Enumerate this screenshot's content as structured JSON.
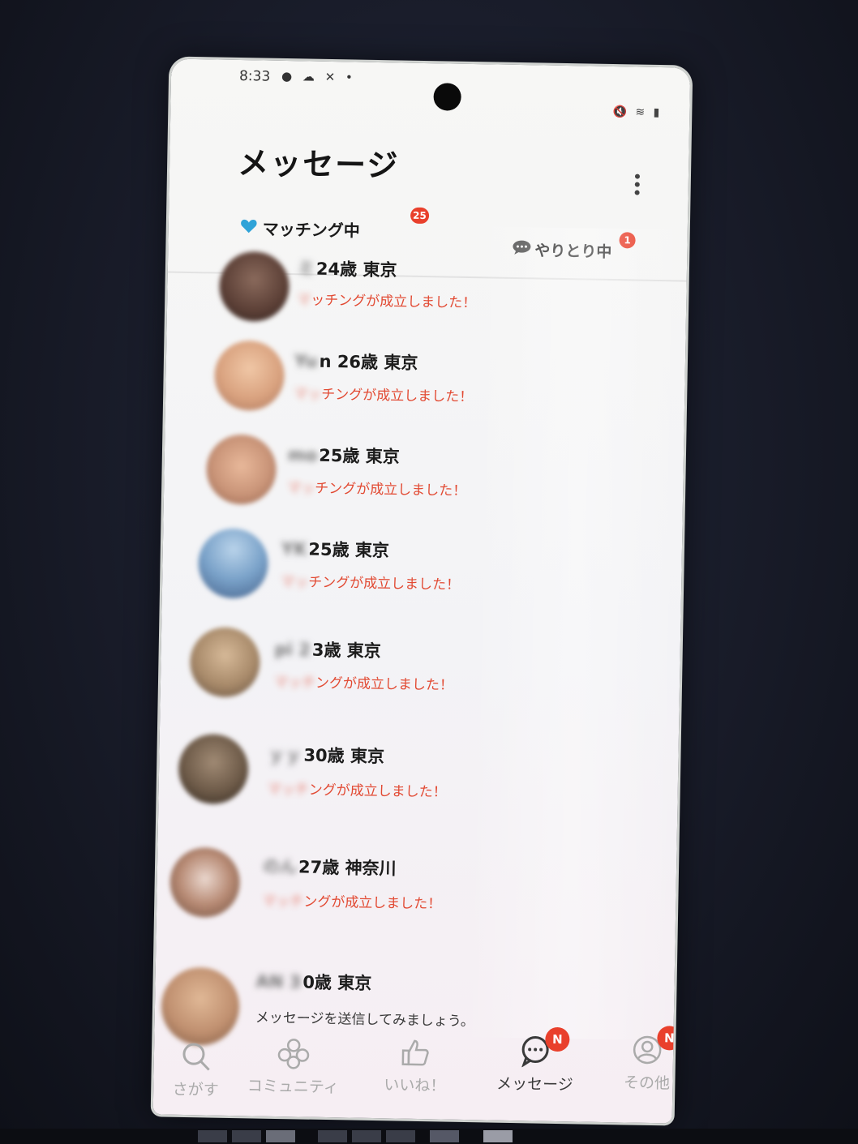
{
  "status_bar": {
    "time": "8:33",
    "left_icons": "● ☁ ✕ •",
    "right_icons": "🔇 ≋ ▮"
  },
  "header": {
    "title": "メッセージ",
    "menu_icon": "kebab-menu-icon"
  },
  "tabs": [
    {
      "label": "マッチング中",
      "badge": "25",
      "icon": "heart-icon",
      "active": true
    },
    {
      "label": "やりとり中",
      "badge": "1",
      "icon": "chat-bubble-icon",
      "active": false
    }
  ],
  "list": [
    {
      "name_hidden": "ミ",
      "name": "24歳 東京",
      "message_hidden": "マ",
      "message": "ッチングが成立しました！",
      "avatar_color": "#5a3e35"
    },
    {
      "name_hidden": "Yu",
      "name": "n 26歳 東京",
      "message_hidden": "マッ",
      "message": "チングが成立しました！",
      "avatar_color": "#d9a27f"
    },
    {
      "name_hidden": "mo",
      "name": "25歳 東京",
      "message_hidden": "マッ",
      "message": "チングが成立しました！",
      "avatar_color": "#c99478"
    },
    {
      "name_hidden": "YK",
      "name": "25歳 東京",
      "message_hidden": "マッ",
      "message": "チングが成立しました！",
      "avatar_color": "#7aa2c9"
    },
    {
      "name_hidden": "pi 2",
      "name": "3歳 東京",
      "message_hidden": "マッチ",
      "message": "ングが成立しました！",
      "avatar_color": "#a88a6a"
    },
    {
      "name_hidden": "ｙｙ",
      "name": "30歳 東京",
      "message_hidden": "マッチ",
      "message": "ングが成立しました！",
      "avatar_color": "#6d5a48"
    },
    {
      "name_hidden": "のん",
      "name": "27歳 神奈川",
      "message_hidden": "マッチ",
      "message": "ングが成立しました！",
      "avatar_color": "#b78a74"
    },
    {
      "name_hidden": "AN 3",
      "name": "0歳 東京",
      "message_hidden": "",
      "message": "メッセージを送信してみましょう。",
      "avatar_color": "#c09070"
    }
  ],
  "bottom_nav": [
    {
      "label": "さがす",
      "icon": "search-icon",
      "badge": ""
    },
    {
      "label": "コミュニティ",
      "icon": "community-icon",
      "badge": ""
    },
    {
      "label": "いいね！",
      "icon": "thumbs-up-icon",
      "badge": ""
    },
    {
      "label": "メッセージ",
      "icon": "chat-bubble-icon",
      "badge": "N",
      "active": true
    },
    {
      "label": "その他",
      "icon": "profile-icon",
      "badge": "N"
    }
  ],
  "colors": {
    "accent": "#e9402c",
    "match_text": "#e24a33",
    "heart": "#2fa3d8"
  }
}
